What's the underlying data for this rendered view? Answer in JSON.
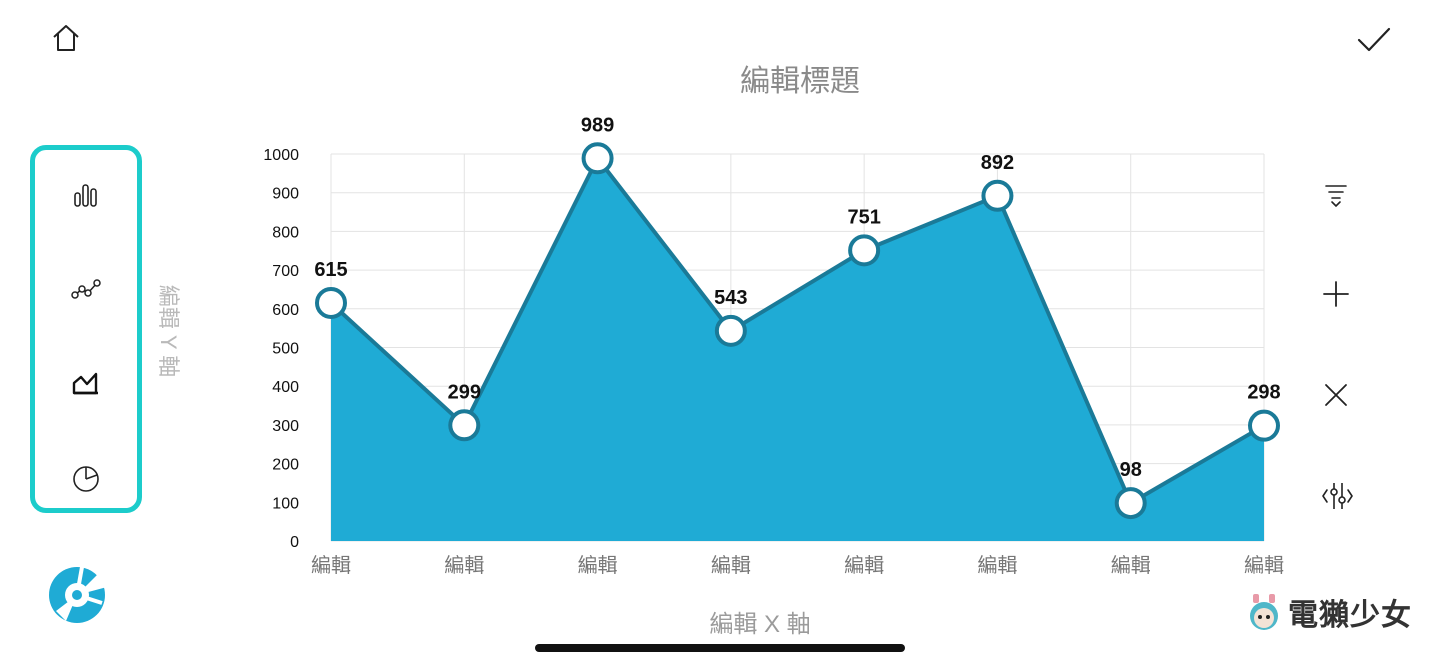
{
  "toolbar": {
    "home_icon": "home-icon",
    "confirm_icon": "check-icon"
  },
  "chart_types": [
    {
      "name": "chart-type-bar",
      "icon": "bar-chart-icon",
      "selected": false
    },
    {
      "name": "chart-type-scatter-line",
      "icon": "scatter-line-icon",
      "selected": false
    },
    {
      "name": "chart-type-area",
      "icon": "area-chart-icon",
      "selected": true
    },
    {
      "name": "chart-type-pie",
      "icon": "pie-chart-icon",
      "selected": false
    }
  ],
  "right_tools": [
    {
      "name": "sort-button",
      "icon": "sort-down-icon"
    },
    {
      "name": "add-data-button",
      "icon": "plus-icon"
    },
    {
      "name": "delete-data-button",
      "icon": "close-icon"
    },
    {
      "name": "settings-button",
      "icon": "sliders-icon"
    }
  ],
  "colors": {
    "accent": "#1ccccb",
    "area_fill": "#1fabd5",
    "line": "#1a7a98",
    "grid": "#e3e3e3"
  },
  "chart_data": {
    "type": "area",
    "title": "編輯標題",
    "xlabel": "編輯 X 軸",
    "ylabel": "編輯 Y 軸",
    "categories": [
      "編輯",
      "編輯",
      "編輯",
      "編輯",
      "編輯",
      "編輯",
      "編輯",
      "編輯"
    ],
    "values": [
      615,
      299,
      989,
      543,
      751,
      892,
      98,
      298
    ],
    "ylim": [
      0,
      1000
    ],
    "yticks": [
      0,
      100,
      200,
      300,
      400,
      500,
      600,
      700,
      800,
      900,
      1000
    ],
    "grid": true,
    "data_labels": true
  },
  "watermark": {
    "text": "電獺少女"
  }
}
